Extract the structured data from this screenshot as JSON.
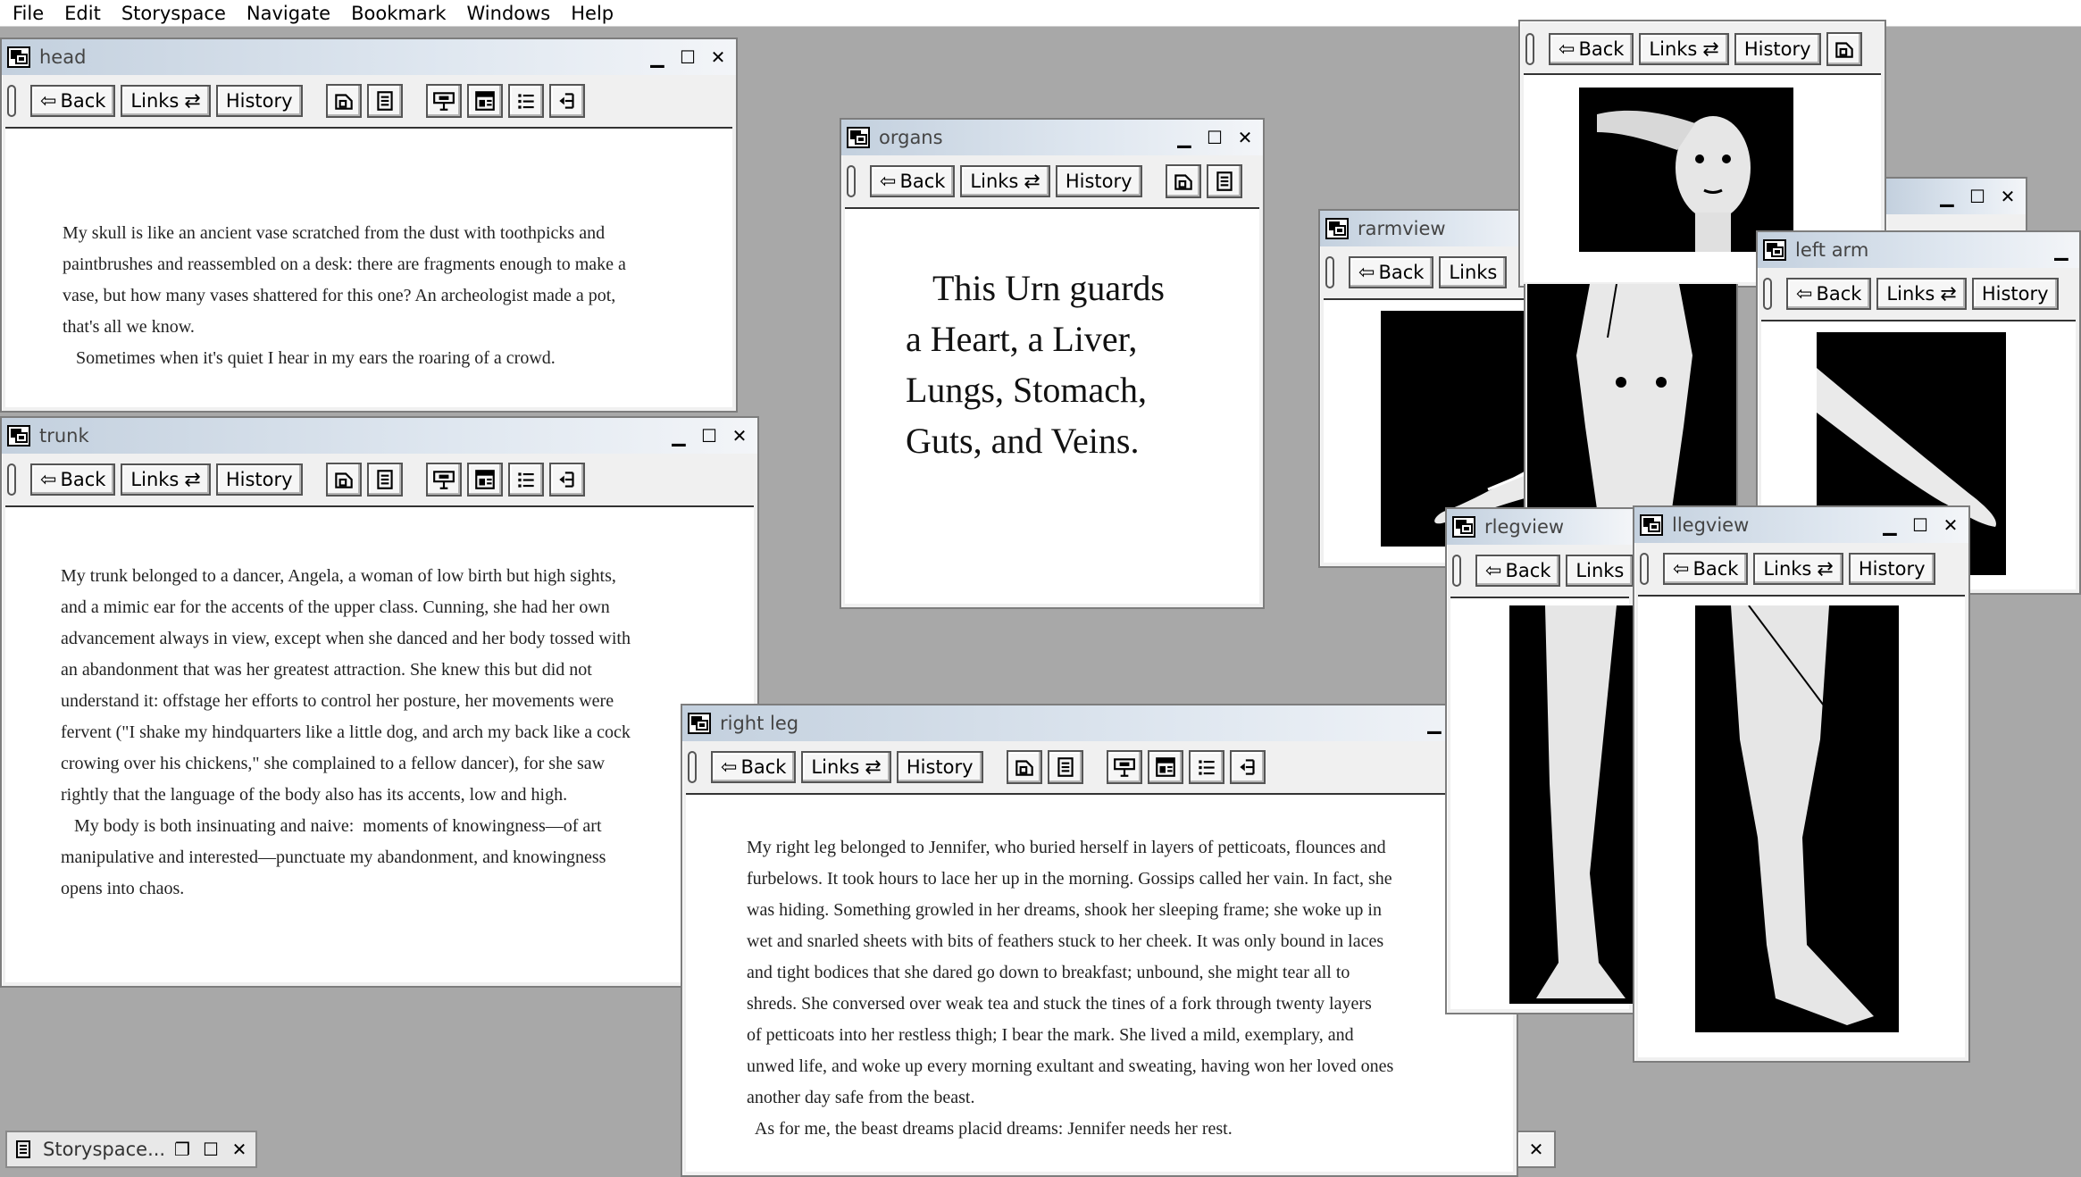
{
  "menu": [
    "File",
    "Edit",
    "Storyspace",
    "Navigate",
    "Bookmark",
    "Windows",
    "Help"
  ],
  "toolbar": {
    "back": "Back",
    "links": "Links",
    "history": "History"
  },
  "windows": {
    "head": {
      "title": "head",
      "paragraphs": [
        "My skull is like an ancient vase scratched from the dust with toothpicks and",
        "paintbrushes and reassembled on a desk: there are fragments enough to make a",
        "vase,  but how many vases shattered for this one? An archeologist made a pot,",
        "that's all we know.",
        "   Sometimes when it's quiet I hear in my ears the roaring of a crowd."
      ]
    },
    "trunk": {
      "title": "trunk",
      "paragraphs": [
        "My trunk belonged to a dancer, Angela, a woman of low birth but high sights,",
        "and a mimic ear for the accents of the upper class.  Cunning, she had her own",
        "advancement always in view, except when she danced and her body tossed with",
        "an abandonment that was her greatest attraction. She knew this but did not",
        "understand it: offstage her efforts to control her posture, her movements were",
        "fervent (\"I shake my hindquarters like a little dog, and arch my back like a cock",
        "crowing over his chickens,\" she complained to a fellow dancer), for she saw",
        "rightly that the language of the body also has its accents, low and high.",
        "   My body is both insinuating and naive:  moments of knowingness—of art",
        "manipulative and interested—punctuate my abandonment, and knowingness",
        "opens into chaos."
      ]
    },
    "organs": {
      "title": "organs",
      "lines": [
        "This Urn guards",
        "a Heart, a Liver,",
        "Lungs, Stomach,",
        "Guts, and Veins."
      ]
    },
    "right_leg": {
      "title": "right leg",
      "paragraphs": [
        "My right leg belonged to Jennifer, who buried herself in layers of petticoats, flounces and",
        "furbelows. It took hours to lace her up in the morning. Gossips called her vain. In fact, she",
        "was hiding. Something growled in her dreams, shook her sleeping frame; she woke up in",
        "wet and snarled sheets with bits of feathers stuck to her cheek. It was only bound in laces",
        "and tight bodices that she dared go down to breakfast; unbound, she might tear all to",
        "shreds.  She conversed over weak tea and stuck the tines of a fork through twenty layers",
        "of petticoats into her restless thigh; I bear the mark. She lived a mild, exemplary, and",
        "unwed life, and woke up every morning exultant and sweating, having won her loved ones",
        "another day safe from the beast.",
        "  As for me, the beast dreams placid dreams: Jennifer needs her rest."
      ]
    },
    "rarmview": {
      "title": "rarmview"
    },
    "left_arm": {
      "title": "left arm"
    },
    "rlegview": {
      "title": "rlegview"
    },
    "llegview": {
      "title": "llegview"
    }
  },
  "taskbar": {
    "label": "Storyspace..."
  }
}
